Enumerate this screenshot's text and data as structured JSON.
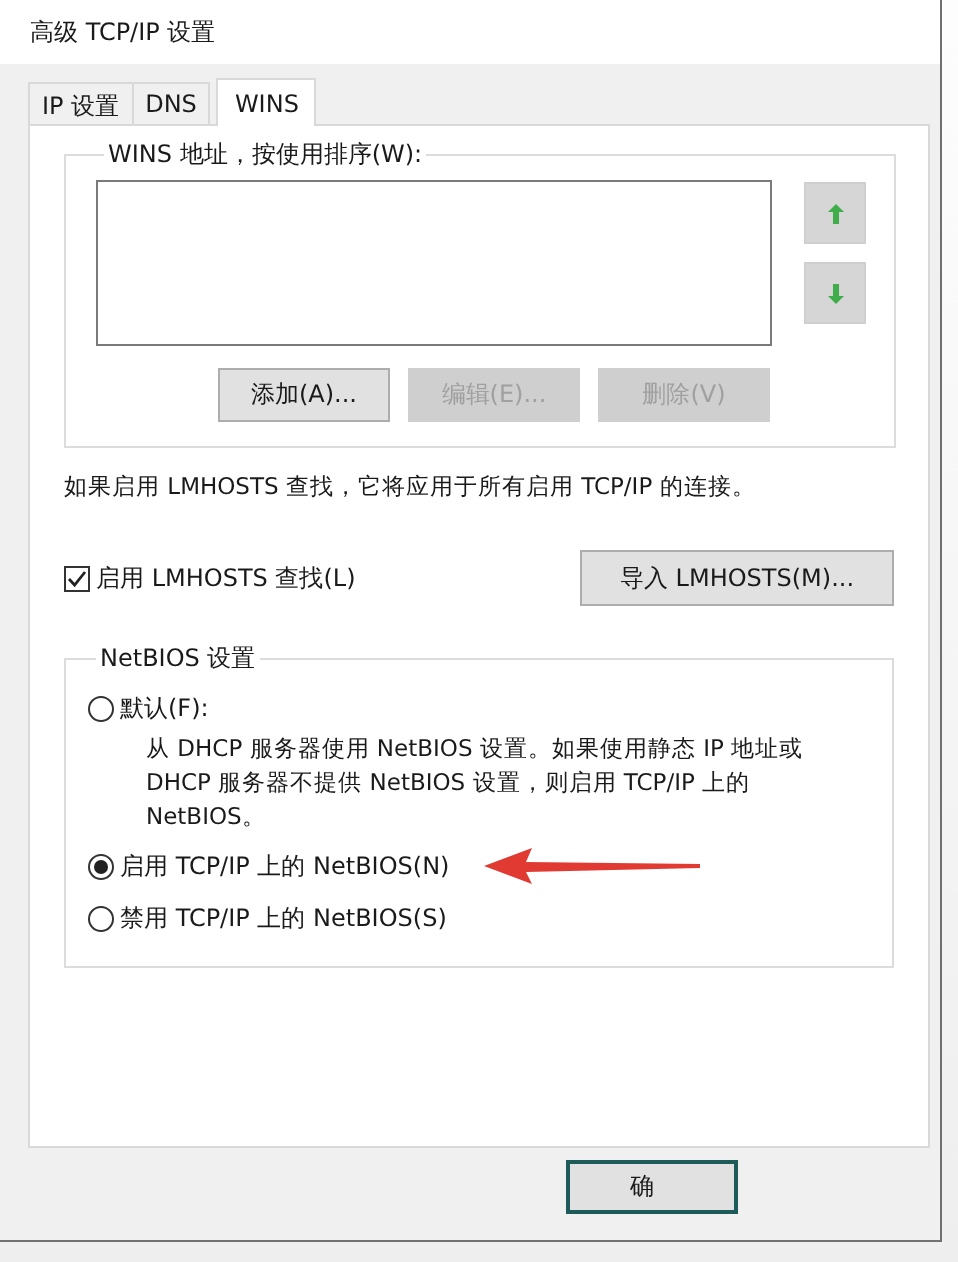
{
  "window": {
    "title": "高级 TCP/IP 设置"
  },
  "tabs": [
    {
      "label": "IP 设置",
      "selected": false
    },
    {
      "label": "DNS",
      "selected": false
    },
    {
      "label": "WINS",
      "selected": true
    }
  ],
  "wins": {
    "title": "WINS 地址，按使用排序(W):",
    "buttons": [
      {
        "label": "添加(A)...",
        "disabled": false
      },
      {
        "label": "编辑(E)...",
        "disabled": true
      },
      {
        "label": "删除(V)",
        "disabled": true
      }
    ]
  },
  "note": "如果启用 LMHOSTS 查找，它将应用于所有启用 TCP/IP 的连接。",
  "lmhosts": {
    "label": "启用 LMHOSTS 查找(L)",
    "checked": true
  },
  "import_button": "导入 LMHOSTS(M)...",
  "netbios": {
    "title": "NetBIOS 设置",
    "options": [
      {
        "label": "默认(F):",
        "selected": false,
        "description": "从 DHCP 服务器使用 NetBIOS 设置。如果使用静态 IP 地址或 DHCP 服务器不提供 NetBIOS 设置，则启用 TCP/IP 上的 NetBIOS。"
      },
      {
        "label": "启用 TCP/IP 上的 NetBIOS(N)",
        "selected": true,
        "annotated": true
      },
      {
        "label": "禁用 TCP/IP 上的 NetBIOS(S)",
        "selected": false
      }
    ]
  },
  "ok_button": "确"
}
